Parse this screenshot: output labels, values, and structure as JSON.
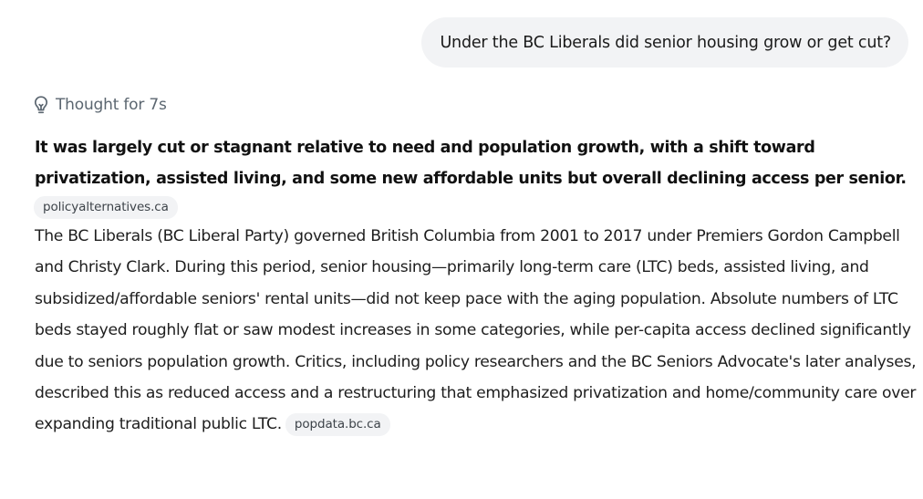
{
  "user_message": {
    "text": "Under the BC Liberals did senior housing grow or get cut?"
  },
  "thought": {
    "icon": "lightbulb-icon",
    "label": "Thought for 7s"
  },
  "answer": {
    "headline": "It was largely cut or stagnant relative to need and population growth, with a shift toward privatization, assisted living, and some new affordable units but overall declining access per senior.",
    "headline_source": "policyalternatives.ca",
    "body": "The BC Liberals (BC Liberal Party) governed British Columbia from 2001 to 2017 under Premiers Gordon Campbell and Christy Clark. During this period, senior housing—primarily long-term care (LTC) beds, assisted living, and subsidized/affordable seniors' rental units—did not keep pace with the aging population. Absolute numbers of LTC beds stayed roughly flat or saw modest increases in some categories, while per-capita access declined significantly due to seniors population growth. Critics, including policy researchers and the BC Seniors Advocate's later analyses, described this as reduced access and a restructuring that emphasized privatization and home/community care over expanding traditional public LTC.",
    "body_source": "popdata.bc.ca"
  }
}
